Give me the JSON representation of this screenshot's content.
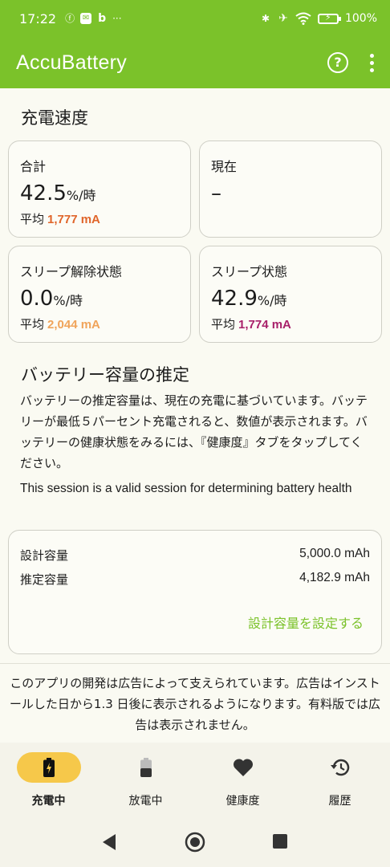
{
  "status_bar": {
    "time": "17:22",
    "battery_pct": "100%"
  },
  "app_bar": {
    "title": "AccuBattery"
  },
  "charge_speed": {
    "title": "充電速度",
    "cards": [
      {
        "label": "合計",
        "value": "42.5",
        "unit": "%/時",
        "avg_label": "平均",
        "avg_value": "1,777 mA",
        "avg_color": "#e0652a"
      },
      {
        "label": "現在",
        "value": "–",
        "unit": "",
        "avg_label": "",
        "avg_value": "",
        "avg_color": "#1c1c1c"
      },
      {
        "label": "スリープ解除状態",
        "value": "0.0",
        "unit": "%/時",
        "avg_label": "平均",
        "avg_value": "2,044 mA",
        "avg_color": "#f0a45a"
      },
      {
        "label": "スリープ状態",
        "value": "42.9",
        "unit": "%/時",
        "avg_label": "平均",
        "avg_value": "1,774 mA",
        "avg_color": "#a8206a"
      }
    ]
  },
  "capacity": {
    "title": "バッテリー容量の推定",
    "description": "バッテリーの推定容量は、現在の充電に基づいています。バッテリーが最低５パーセント充電されると、数値が表示されます。バッテリーの健康状態をみるには、『健康度』タブをタップしてください。",
    "session_note": "This session is a valid session for determining battery health",
    "design_label": "設計容量",
    "design_value": "5,000.0 mAh",
    "estimated_label": "推定容量",
    "estimated_value": "4,182.9 mAh",
    "set_link": "設計容量を設定する"
  },
  "ad_notice": "このアプリの開発は広告によって支えられています。広告はインストールした日から1.3 日後に表示されるようになります。有料版では広告は表示されません。",
  "bottom_nav": [
    {
      "label": "充電中",
      "icon": "battery-charging-icon",
      "active": true
    },
    {
      "label": "放電中",
      "icon": "battery-icon",
      "active": false
    },
    {
      "label": "健康度",
      "icon": "heart-icon",
      "active": false
    },
    {
      "label": "履歴",
      "icon": "history-icon",
      "active": false
    }
  ],
  "colors": {
    "accent": "#7bc22a",
    "active_pill": "#f6c84a"
  }
}
